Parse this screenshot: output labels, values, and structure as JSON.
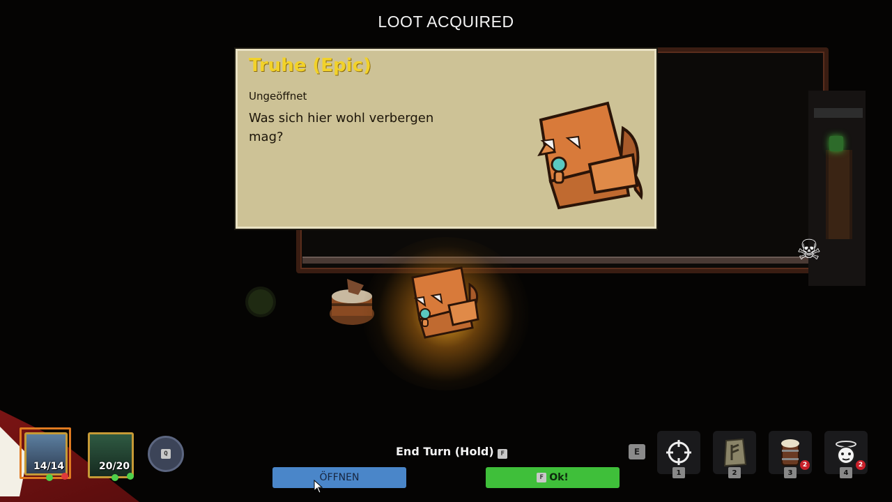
{
  "header": {
    "title": "LOOT ACQUIRED"
  },
  "loot_card": {
    "name": "Truhe (Epic)",
    "state": "Ungeöffnet",
    "description": "Was sich hier wohl verbergen mag?"
  },
  "hud": {
    "hero1_hp": "14/14",
    "hero2_hp": "20/20",
    "swap_key": "Q",
    "end_turn_label": "End Turn (Hold)",
    "end_turn_key": "F",
    "open_button": "ÖFFNEN",
    "ok_key": "F",
    "ok_button": "Ok!",
    "ability_key": "E",
    "slots": [
      {
        "num": "1",
        "icon": "crosshair-icon"
      },
      {
        "num": "2",
        "icon": "rune-stone-icon"
      },
      {
        "num": "3",
        "icon": "beer-keg-icon",
        "badge": "2"
      },
      {
        "num": "4",
        "icon": "dizzy-face-icon",
        "badge": "2"
      }
    ]
  },
  "colors": {
    "epic": "#f2d22a",
    "open_button": "#4a86c9",
    "ok_button": "#3fbf3a"
  }
}
